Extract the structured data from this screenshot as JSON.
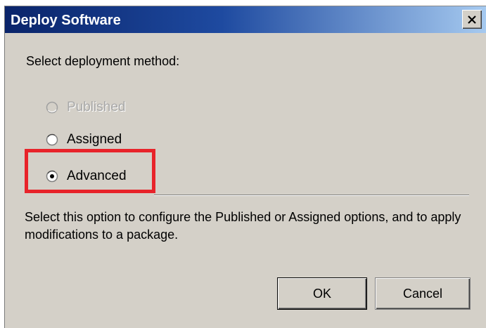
{
  "window": {
    "title": "Deploy Software"
  },
  "prompt": "Select deployment method:",
  "options": [
    {
      "label": "Published",
      "selected": false,
      "enabled": false
    },
    {
      "label": "Assigned",
      "selected": false,
      "enabled": true
    },
    {
      "label": "Advanced",
      "selected": true,
      "enabled": true
    }
  ],
  "description": "Select this option to configure the Published or Assigned options, and to apply modifications to a package.",
  "buttons": {
    "ok_label": "OK",
    "cancel_label": "Cancel"
  },
  "colors": {
    "titlebar_start": "#0a246a",
    "titlebar_end": "#a6caf0",
    "dialog_bg": "#d4d0c8",
    "highlight": "#e8232a"
  },
  "icons": {
    "close": "close-icon",
    "radio_empty": "radio-unselected-icon",
    "radio_selected": "radio-selected-icon"
  }
}
